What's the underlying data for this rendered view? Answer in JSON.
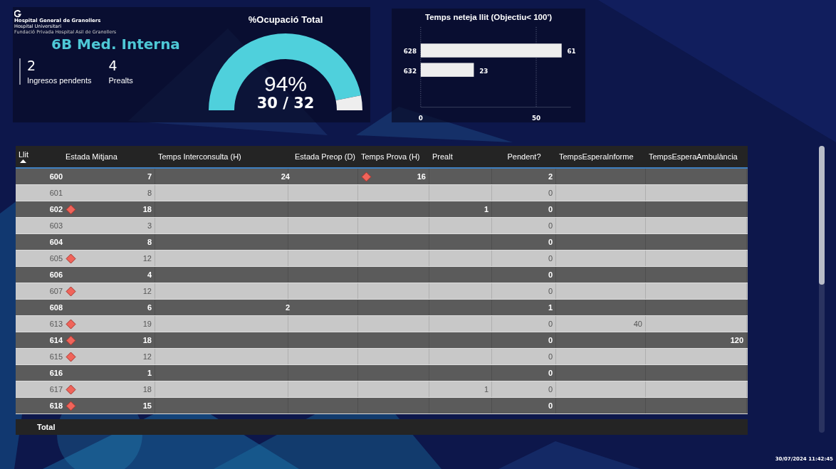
{
  "logo": {
    "name": "Hospital General de Granollers",
    "subtitle": "Hospital Universitari",
    "foundation": "Fundació Privada Hospital Asil de Granollers"
  },
  "unit_title": "6B Med. Interna",
  "kpis": [
    {
      "value": "2",
      "label": "Ingresos pendents"
    },
    {
      "value": "4",
      "label": "Prealts"
    }
  ],
  "occupancy": {
    "title": "%Ocupació Total",
    "percent": "94%",
    "ratio": "30 / 32"
  },
  "cleaning_chart": {
    "title": "Temps neteja llit (Objectiu< 100')",
    "chart_data": {
      "type": "bar",
      "orientation": "horizontal",
      "categories": [
        "628",
        "632"
      ],
      "series": [
        {
          "color": "#eeeeee",
          "values": [
            61,
            23
          ]
        }
      ],
      "xticks": [
        0,
        50
      ],
      "xlim": [
        0,
        65
      ],
      "data_labels": true
    }
  },
  "table": {
    "columns": [
      {
        "label": "Llit",
        "sorted": true
      },
      {
        "label": "Estada Mitjana"
      },
      {
        "label": "Temps Interconsulta (H)"
      },
      {
        "label": "Estada Preop (D)"
      },
      {
        "label": "Temps Prova (H)"
      },
      {
        "label": "Prealt"
      },
      {
        "label": "Pendent?"
      },
      {
        "label": "TempsEsperaInforme"
      },
      {
        "label": "TempsEsperaAmbulància"
      }
    ],
    "rows": [
      {
        "bed": "600",
        "alert": false,
        "stay": "7",
        "interconsult": "24",
        "test_alert": true,
        "test": "16",
        "pending": "2"
      },
      {
        "bed": "601",
        "alert": false,
        "stay": "8",
        "test_alert": false,
        "pending": "0"
      },
      {
        "bed": "602",
        "alert": true,
        "stay": "18",
        "test_alert": false,
        "prealt": "1",
        "pending": "0"
      },
      {
        "bed": "603",
        "alert": false,
        "stay": "3",
        "test_alert": false,
        "pending": "0"
      },
      {
        "bed": "604",
        "alert": false,
        "stay": "8",
        "test_alert": false,
        "pending": "0"
      },
      {
        "bed": "605",
        "alert": true,
        "stay": "12",
        "test_alert": false,
        "pending": "0"
      },
      {
        "bed": "606",
        "alert": false,
        "stay": "4",
        "test_alert": false,
        "pending": "0"
      },
      {
        "bed": "607",
        "alert": true,
        "stay": "12",
        "test_alert": false,
        "pending": "0"
      },
      {
        "bed": "608",
        "alert": false,
        "stay": "6",
        "interconsult": "2",
        "test_alert": false,
        "pending": "1"
      },
      {
        "bed": "613",
        "alert": true,
        "stay": "19",
        "test_alert": false,
        "pending": "0",
        "report_wait": "40"
      },
      {
        "bed": "614",
        "alert": true,
        "stay": "18",
        "test_alert": false,
        "pending": "0",
        "ambulance_wait": "120"
      },
      {
        "bed": "615",
        "alert": true,
        "stay": "12",
        "test_alert": false,
        "pending": "0"
      },
      {
        "bed": "616",
        "alert": false,
        "stay": "1",
        "test_alert": false,
        "pending": "0"
      },
      {
        "bed": "617",
        "alert": true,
        "stay": "18",
        "test_alert": false,
        "prealt": "1",
        "pending": "0"
      },
      {
        "bed": "618",
        "alert": true,
        "stay": "15",
        "test_alert": false,
        "pending": "0"
      }
    ],
    "total_label": "Total"
  },
  "timestamp": "30/07/2024 11:42:45"
}
